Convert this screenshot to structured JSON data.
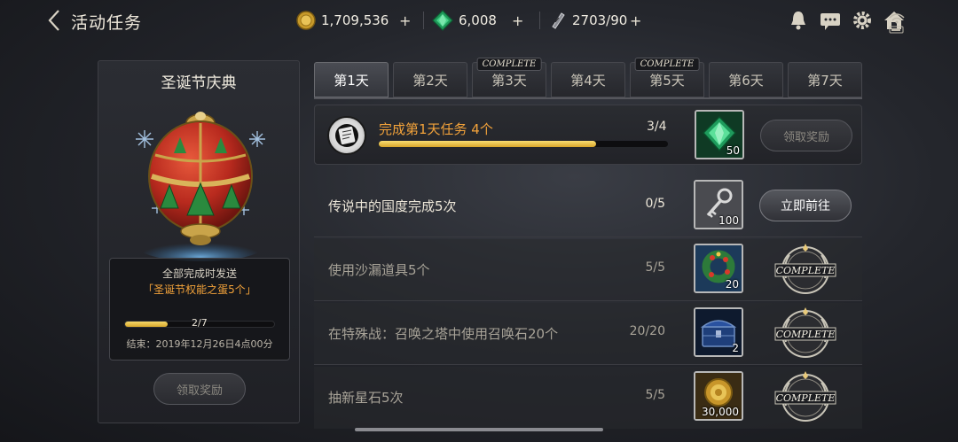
{
  "header": {
    "title": "活动任务",
    "back_icon": "back-chevron-icon",
    "resources": [
      {
        "name": "gold",
        "icon": "gold-coin-icon",
        "value": "1,709,536"
      },
      {
        "name": "gem",
        "icon": "green-gem-icon",
        "value": "6,008"
      },
      {
        "name": "stamina",
        "icon": "ticket-icon",
        "value": "2703/90"
      }
    ],
    "icons": [
      "bell-icon",
      "chat-icon",
      "gear-icon",
      "home-icon"
    ]
  },
  "event": {
    "title": "圣诞节庆典",
    "reward_label": "全部完成时发送",
    "reward_item": "「圣诞节权能之蛋5个」",
    "progress_text": "2/7",
    "progress_fraction": 0.2857,
    "end_time": "结束：2019年12月26日4点00分",
    "claim_label": "领取奖励"
  },
  "tabs": [
    {
      "label": "第1天",
      "active": true,
      "complete": false
    },
    {
      "label": "第2天",
      "active": false,
      "complete": false
    },
    {
      "label": "第3天",
      "active": false,
      "complete": true
    },
    {
      "label": "第4天",
      "active": false,
      "complete": false
    },
    {
      "label": "第5天",
      "active": false,
      "complete": true
    },
    {
      "label": "第6天",
      "active": false,
      "complete": false
    },
    {
      "label": "第7天",
      "active": false,
      "complete": false
    }
  ],
  "complete_label": "COMPLETE",
  "main_task": {
    "text": "完成第1天任务 4个",
    "count": "3/4",
    "progress_fraction": 0.75,
    "reward_icon": "green-gem-icon",
    "reward_count": "50",
    "claim_label": "领取奖励"
  },
  "tasks": [
    {
      "name": "传说中的国度完成5次",
      "count": "0/5",
      "reward_icon": "key-icon",
      "reward_count": "100",
      "status": "go",
      "button_label": "立即前往"
    },
    {
      "name": "使用沙漏道具5个",
      "count": "5/5",
      "reward_icon": "wreath-icon",
      "reward_count": "20",
      "status": "complete"
    },
    {
      "name": "在特殊战：召唤之塔中使用召唤石20个",
      "count": "20/20",
      "reward_icon": "chest-icon",
      "reward_count": "2",
      "status": "complete"
    },
    {
      "name": "抽新星石5次",
      "count": "5/5",
      "reward_icon": "gold-coin-icon",
      "reward_count": "30,000",
      "status": "complete"
    }
  ],
  "colors": {
    "accent_orange": "#f2a23a",
    "progress_gold": "#e6b83e",
    "background": "#24262c"
  }
}
